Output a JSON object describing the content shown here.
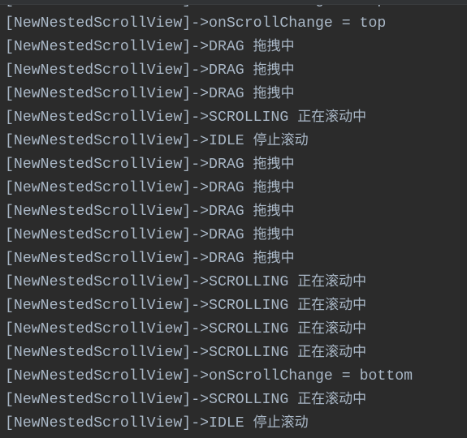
{
  "console": {
    "lines": [
      {
        "prefix": "[NewNestedScrollView]->",
        "msg": "onScrollChange = top",
        "cn": ""
      },
      {
        "prefix": "[NewNestedScrollView]->",
        "msg": "onScrollChange = top",
        "cn": ""
      },
      {
        "prefix": "[NewNestedScrollView]->",
        "msg": "DRAG ",
        "cn": "拖拽中"
      },
      {
        "prefix": "[NewNestedScrollView]->",
        "msg": "DRAG ",
        "cn": "拖拽中"
      },
      {
        "prefix": "[NewNestedScrollView]->",
        "msg": "DRAG ",
        "cn": "拖拽中"
      },
      {
        "prefix": "[NewNestedScrollView]->",
        "msg": "SCROLLING ",
        "cn": "正在滚动中"
      },
      {
        "prefix": "[NewNestedScrollView]->",
        "msg": "IDLE ",
        "cn": "停止滚动"
      },
      {
        "prefix": "[NewNestedScrollView]->",
        "msg": "DRAG ",
        "cn": "拖拽中"
      },
      {
        "prefix": "[NewNestedScrollView]->",
        "msg": "DRAG ",
        "cn": "拖拽中"
      },
      {
        "prefix": "[NewNestedScrollView]->",
        "msg": "DRAG ",
        "cn": "拖拽中"
      },
      {
        "prefix": "[NewNestedScrollView]->",
        "msg": "DRAG ",
        "cn": "拖拽中"
      },
      {
        "prefix": "[NewNestedScrollView]->",
        "msg": "DRAG ",
        "cn": "拖拽中"
      },
      {
        "prefix": "[NewNestedScrollView]->",
        "msg": "SCROLLING ",
        "cn": "正在滚动中"
      },
      {
        "prefix": "[NewNestedScrollView]->",
        "msg": "SCROLLING ",
        "cn": "正在滚动中"
      },
      {
        "prefix": "[NewNestedScrollView]->",
        "msg": "SCROLLING ",
        "cn": "正在滚动中"
      },
      {
        "prefix": "[NewNestedScrollView]->",
        "msg": "SCROLLING ",
        "cn": "正在滚动中"
      },
      {
        "prefix": "[NewNestedScrollView]->",
        "msg": "onScrollChange = bottom",
        "cn": ""
      },
      {
        "prefix": "[NewNestedScrollView]->",
        "msg": "SCROLLING ",
        "cn": "正在滚动中"
      },
      {
        "prefix": "[NewNestedScrollView]->",
        "msg": "IDLE ",
        "cn": "停止滚动"
      }
    ]
  }
}
